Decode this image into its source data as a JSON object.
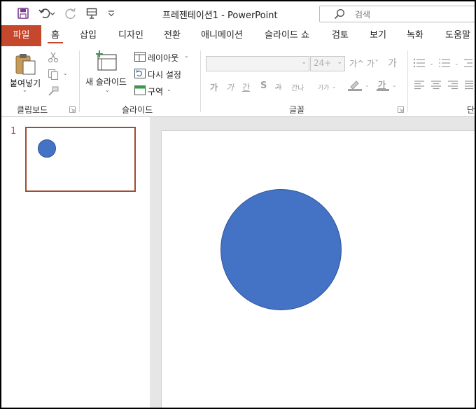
{
  "window": {
    "title": "프레젠테이션1  -  PowerPoint",
    "search_placeholder": "검색"
  },
  "quick_access": {
    "save": "save-icon",
    "undo": "undo-icon",
    "redo": "redo-icon",
    "present": "present-icon",
    "customize": "customize-icon"
  },
  "tabs": [
    {
      "label": "파일",
      "kind": "file"
    },
    {
      "label": "홈",
      "kind": "active"
    },
    {
      "label": "삽입"
    },
    {
      "label": "디자인"
    },
    {
      "label": "전환"
    },
    {
      "label": "애니메이션"
    },
    {
      "label": "슬라이드 쇼"
    },
    {
      "label": "검토"
    },
    {
      "label": "보기"
    },
    {
      "label": "녹화"
    },
    {
      "label": "도움말"
    }
  ],
  "ribbon": {
    "clipboard": {
      "paste_label": "붙여넣기",
      "group_label": "클립보드"
    },
    "slides": {
      "new_slide_label": "새 슬라이드",
      "layout_label": "레이아웃",
      "reset_label": "다시 설정",
      "section_label": "구역",
      "group_label": "슬라이드"
    },
    "font": {
      "font_size_value": "24+",
      "grow_label": "가^",
      "shrink_label": "가ˇ",
      "bold": "가",
      "italic": "가",
      "underline": "간",
      "shadow": "S",
      "strike": "가",
      "spacing": "간나",
      "case": "가가",
      "color_a": "가",
      "clear": "가",
      "group_label": "글꼴"
    },
    "paragraph": {
      "group_label_partial": "단"
    }
  },
  "slides_pane": {
    "items": [
      {
        "number": "1"
      }
    ]
  },
  "colors": {
    "accent": "#c5472c",
    "shape_fill": "#4472c4",
    "shape_border": "#2f5597"
  }
}
